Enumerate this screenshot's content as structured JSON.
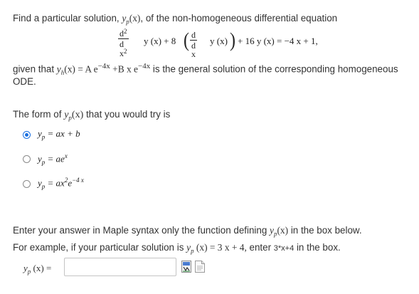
{
  "question": {
    "line1_prefix": "Find a particular solution, ",
    "line1_yp": "y",
    "line1_yp_sub": "p",
    "line1_arg": "(x)",
    "line1_suffix": ", of the non-homogeneous differential equation",
    "equation": {
      "frac1_num": "d",
      "frac1_num_sup": "2",
      "frac1_den": "d x",
      "frac1_den_sup": "2",
      "term1": "y (x) + 8",
      "frac2_num": "d",
      "frac2_den": "d x",
      "term2": "y (x)",
      "rest": "+ 16 y (x) = −4 x + 1,"
    },
    "given_prefix": "given that ",
    "given_yh": "y",
    "given_yh_sub": "h",
    "given_expr_a": "(x) = A e",
    "given_sup1": "−4x",
    "given_expr_b": " +B x e",
    "given_sup2": "−4x",
    "given_suffix": " is the general solution of the corresponding homogeneous",
    "line_ode": "ODE."
  },
  "form": {
    "prompt_prefix": "The form of ",
    "prompt_y": "y",
    "prompt_sub": "p",
    "prompt_arg": "(x)",
    "prompt_suffix": " that you would try is",
    "options": [
      {
        "yp": "y",
        "sub": "p",
        "eq": " = ax + b",
        "sup": "",
        "tail": "",
        "tail_sup": "",
        "selected": true
      },
      {
        "yp": "y",
        "sub": "p",
        "eq": " = ae",
        "sup": "x",
        "tail": "",
        "tail_sup": "",
        "selected": false
      },
      {
        "yp": "y",
        "sub": "p",
        "eq": " = ax",
        "sup": "2",
        "tail": "e",
        "tail_sup": "−4 x",
        "selected": false
      }
    ]
  },
  "instructions": {
    "line1_prefix": "Enter your answer in Maple syntax only the function defining ",
    "line1_y": "y",
    "line1_sub": "p",
    "line1_arg": "(x)",
    "line1_suffix": " in the box below.",
    "line2_prefix": "For example, if your particular solution is ",
    "line2_y": "y",
    "line2_sub": "p",
    "line2_expr": " (x) = 3 x + 4,",
    "line2_mid": "  enter ",
    "line2_code": "3*x+4",
    "line2_suffix": " in the box."
  },
  "answer": {
    "label_y": "y",
    "label_sub": "p",
    "label_rest": " (x) =",
    "value": "",
    "icon1": "equation-editor-icon",
    "icon2": "preview-document-icon"
  },
  "colors": {
    "accent": "#1a6fe0",
    "text": "#333333"
  }
}
